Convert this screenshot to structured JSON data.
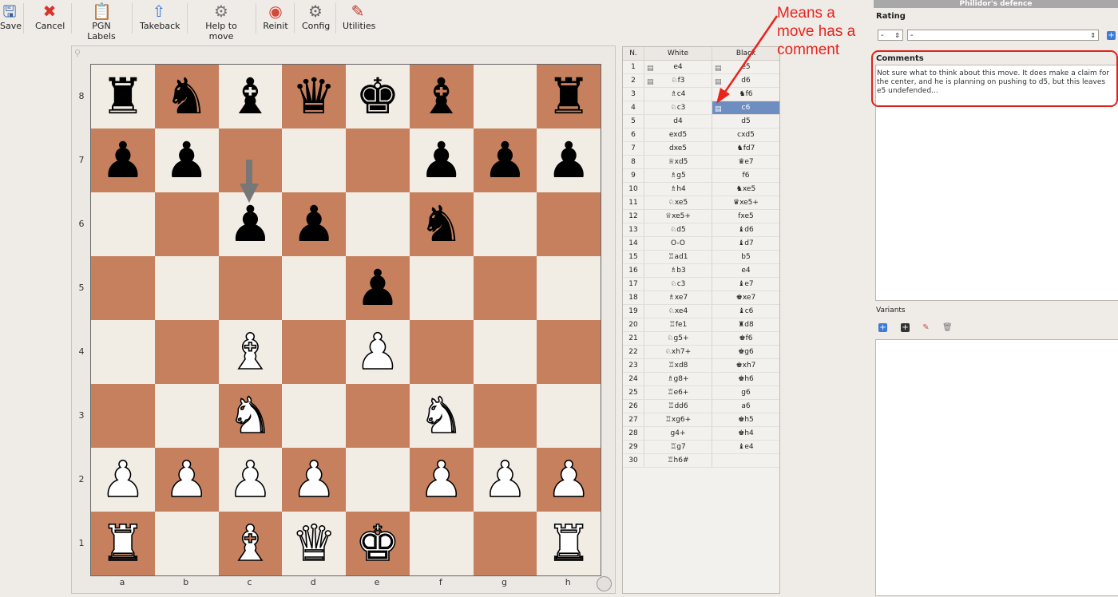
{
  "toolbar": {
    "buttons": [
      {
        "label": "Save",
        "icon": "save-icon"
      },
      {
        "label": "Cancel",
        "icon": "cancel-icon"
      },
      {
        "label": "PGN Labels",
        "icon": "pgn-labels-icon"
      },
      {
        "label": "Takeback",
        "icon": "takeback-icon"
      },
      {
        "label": "Help to move",
        "icon": "help-to-move-icon"
      },
      {
        "label": "Reinit",
        "icon": "reinit-icon"
      },
      {
        "label": "Config",
        "icon": "config-icon"
      },
      {
        "label": "Utilities",
        "icon": "utilities-icon"
      }
    ]
  },
  "annotation": {
    "text": "Means a move has a comment",
    "color": "#e8241d"
  },
  "board": {
    "ranks": [
      "8",
      "7",
      "6",
      "5",
      "4",
      "3",
      "2",
      "1"
    ],
    "files": [
      "a",
      "b",
      "c",
      "d",
      "e",
      "f",
      "g",
      "h"
    ],
    "light_color": "#f1ede5",
    "dark_color": "#c6805d",
    "position": [
      [
        "br",
        "bn",
        "bb",
        "bq",
        "bk",
        "bb",
        "",
        "br"
      ],
      [
        "bp",
        "bp",
        "",
        "",
        "",
        "bp",
        "bp",
        "bp"
      ],
      [
        "",
        "",
        "bp",
        "bp",
        "",
        "bn",
        "",
        ""
      ],
      [
        "",
        "",
        "",
        "",
        "bp",
        "",
        "",
        ""
      ],
      [
        "",
        "",
        "wb",
        "",
        "wp",
        "",
        "",
        ""
      ],
      [
        "",
        "",
        "wn",
        "",
        "",
        "wn",
        "",
        ""
      ],
      [
        "wp",
        "wp",
        "wp",
        "wp",
        "",
        "wp",
        "wp",
        "wp"
      ],
      [
        "wr",
        "",
        "wb",
        "wq",
        "wk",
        "",
        "",
        "wr"
      ]
    ]
  },
  "moves": {
    "headers": {
      "n": "N.",
      "white": "White",
      "black": "Black"
    },
    "rows": [
      {
        "n": "1",
        "w": "e4",
        "b": "e5"
      },
      {
        "n": "2",
        "w": "♘f3",
        "b": "d6"
      },
      {
        "n": "3",
        "w": "♗c4",
        "b": "♞f6"
      },
      {
        "n": "4",
        "w": "♘c3",
        "b": "c6"
      },
      {
        "n": "5",
        "w": "d4",
        "b": "d5"
      },
      {
        "n": "6",
        "w": "exd5",
        "b": "cxd5"
      },
      {
        "n": "7",
        "w": "dxe5",
        "b": "♞fd7"
      },
      {
        "n": "8",
        "w": "♕xd5",
        "b": "♛e7"
      },
      {
        "n": "9",
        "w": "♗g5",
        "b": "f6"
      },
      {
        "n": "10",
        "w": "♗h4",
        "b": "♞xe5"
      },
      {
        "n": "11",
        "w": "♘xe5",
        "b": "♛xe5+"
      },
      {
        "n": "12",
        "w": "♕xe5+",
        "b": "fxe5"
      },
      {
        "n": "13",
        "w": "♘d5",
        "b": "♝d6"
      },
      {
        "n": "14",
        "w": "O-O",
        "b": "♝d7"
      },
      {
        "n": "15",
        "w": "♖ad1",
        "b": "b5"
      },
      {
        "n": "16",
        "w": "♗b3",
        "b": "e4"
      },
      {
        "n": "17",
        "w": "♘c3",
        "b": "♝e7"
      },
      {
        "n": "18",
        "w": "♗xe7",
        "b": "♚xe7"
      },
      {
        "n": "19",
        "w": "♘xe4",
        "b": "♝c6"
      },
      {
        "n": "20",
        "w": "♖fe1",
        "b": "♜d8"
      },
      {
        "n": "21",
        "w": "♘g5+",
        "b": "♚f6"
      },
      {
        "n": "22",
        "w": "♘xh7+",
        "b": "♚g6"
      },
      {
        "n": "23",
        "w": "♖xd8",
        "b": "♚xh7"
      },
      {
        "n": "24",
        "w": "♗g8+",
        "b": "♚h6"
      },
      {
        "n": "25",
        "w": "♖e6+",
        "b": "g6"
      },
      {
        "n": "26",
        "w": "♖dd6",
        "b": "a6"
      },
      {
        "n": "27",
        "w": "♖xg6+",
        "b": "♚h5"
      },
      {
        "n": "28",
        "w": "g4+",
        "b": "♚h4"
      },
      {
        "n": "29",
        "w": "♖g7",
        "b": "♝e4"
      },
      {
        "n": "30",
        "w": "♖h6#",
        "b": ""
      }
    ]
  },
  "sidebar": {
    "title": "Philidor's defence",
    "rating_label": "Rating",
    "rating_value": "-",
    "rating_value2": "-",
    "comments_label": "Comments",
    "comments_text": "Not sure what to think about this move. It does make a claim for the center, and he is planning on pushing to d5, but this leaves e5 undefended...",
    "variants_label": "Variants"
  }
}
